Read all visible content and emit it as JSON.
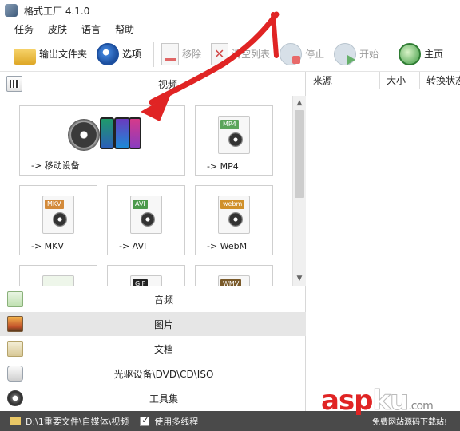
{
  "window": {
    "title": "格式工厂 4.1.0"
  },
  "menu": [
    "任务",
    "皮肤",
    "语言",
    "帮助"
  ],
  "toolbar": {
    "output_folder": "输出文件夹",
    "options": "选项",
    "remove": "移除",
    "clear_list": "清空列表",
    "stop": "停止",
    "start": "开始",
    "home": "主页"
  },
  "categories": {
    "video": "视频",
    "audio": "音频",
    "image": "图片",
    "document": "文档",
    "disc": "光驱设备\\DVD\\CD\\ISO",
    "tools": "工具集"
  },
  "tiles": [
    {
      "label": "-> 移动设备"
    },
    {
      "label": "-> MP4",
      "badge": "MP4"
    },
    {
      "label": "-> MKV",
      "badge": "MKV"
    },
    {
      "label": "-> AVI",
      "badge": "AVI"
    },
    {
      "label": "-> WebM",
      "badge": "webm"
    },
    {
      "label": "",
      "badge": ""
    },
    {
      "label": "",
      "badge": "GIF"
    },
    {
      "label": "",
      "badge": "WMV"
    }
  ],
  "task_table": {
    "columns": [
      "来源",
      "大小",
      "转换状态"
    ]
  },
  "statusbar": {
    "path": "D:\\1重要文件\\自媒体\\视频",
    "multithread": "使用多线程"
  },
  "watermark": {
    "asp": "asp",
    "ku": "ku",
    "com": ".com",
    "sub": "免费网站源码下载站!"
  },
  "colors": {
    "accent_red": "#e02424",
    "statusbar_bg": "#4a4a4a",
    "badge_mp4": "#5aa55a",
    "badge_mkv": "#d38a3a",
    "badge_avi": "#4c9a4c",
    "badge_webm": "#d0902a",
    "badge_gif": "#222222",
    "badge_wmv": "#7a5a2a"
  }
}
